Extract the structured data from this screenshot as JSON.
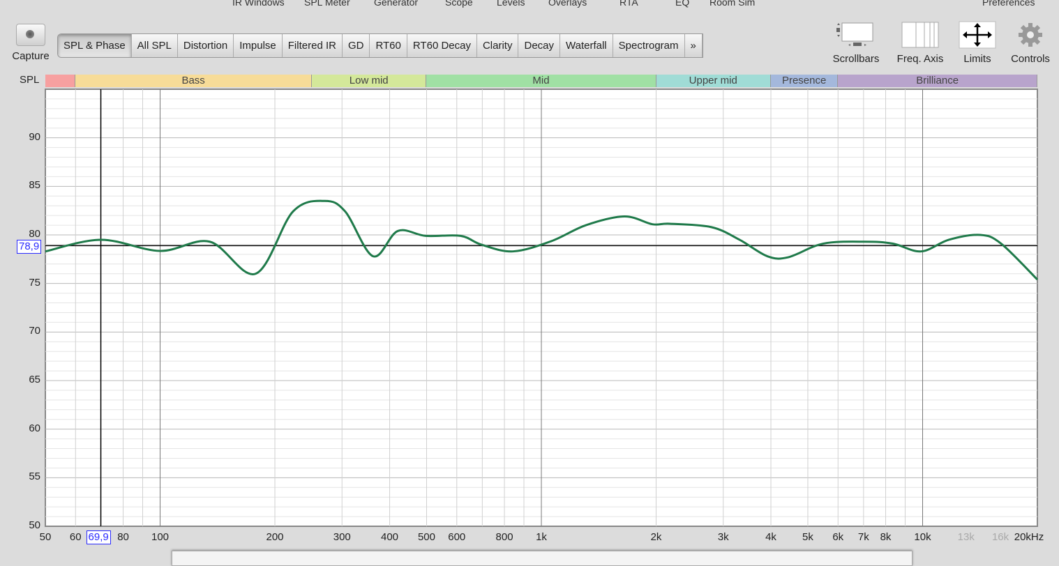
{
  "top_menu": [
    "IR Windows",
    "SPL Meter",
    "Generator",
    "Scope",
    "Levels",
    "Overlays",
    "RTA",
    "EQ",
    "Room Sim",
    "Preferences"
  ],
  "capture_label": "Capture",
  "tabs": [
    "SPL & Phase",
    "All SPL",
    "Distortion",
    "Impulse",
    "Filtered IR",
    "GD",
    "RT60",
    "RT60 Decay",
    "Clarity",
    "Decay",
    "Waterfall",
    "Spectrogram",
    "»"
  ],
  "active_tab": "SPL & Phase",
  "tools": [
    "Scrollbars",
    "Freq. Axis",
    "Limits",
    "Controls"
  ],
  "cursor": {
    "freq_label": "69,9",
    "spl_label": "78,9",
    "freq": 69.9,
    "spl": 78.9
  },
  "chart_data": {
    "type": "line",
    "ylabel": "SPL",
    "xscale": "log",
    "xlim": [
      50,
      20000
    ],
    "ylim": [
      50,
      95
    ],
    "yticks": [
      50,
      55,
      60,
      65,
      70,
      75,
      80,
      85,
      90
    ],
    "xticks": [
      {
        "v": 50,
        "l": "50"
      },
      {
        "v": 60,
        "l": "60"
      },
      {
        "v": 80,
        "l": "80"
      },
      {
        "v": 100,
        "l": "100"
      },
      {
        "v": 200,
        "l": "200"
      },
      {
        "v": 300,
        "l": "300"
      },
      {
        "v": 400,
        "l": "400"
      },
      {
        "v": 500,
        "l": "500"
      },
      {
        "v": 600,
        "l": "600"
      },
      {
        "v": 800,
        "l": "800"
      },
      {
        "v": 1000,
        "l": "1k"
      },
      {
        "v": 2000,
        "l": "2k"
      },
      {
        "v": 3000,
        "l": "3k"
      },
      {
        "v": 4000,
        "l": "4k"
      },
      {
        "v": 5000,
        "l": "5k"
      },
      {
        "v": 6000,
        "l": "6k"
      },
      {
        "v": 7000,
        "l": "7k"
      },
      {
        "v": 8000,
        "l": "8k"
      },
      {
        "v": 10000,
        "l": "10k"
      },
      {
        "v": 13000,
        "l": "13k",
        "dim": true
      },
      {
        "v": 16000,
        "l": "16k",
        "dim": true
      },
      {
        "v": 20000,
        "l": "20kHz"
      }
    ],
    "bands": [
      {
        "name": "",
        "from": 20,
        "to": 60,
        "color": "#f7a0a0"
      },
      {
        "name": "Bass",
        "from": 60,
        "to": 250,
        "color": "#f7dc98"
      },
      {
        "name": "Low mid",
        "from": 250,
        "to": 500,
        "color": "#d4e89a"
      },
      {
        "name": "Mid",
        "from": 500,
        "to": 2000,
        "color": "#a0e0a4"
      },
      {
        "name": "Upper mid",
        "from": 2000,
        "to": 4000,
        "color": "#a0dcd6"
      },
      {
        "name": "Presence",
        "from": 4000,
        "to": 6000,
        "color": "#a4b8dc"
      },
      {
        "name": "Brilliance",
        "from": 6000,
        "to": 20000,
        "color": "#b8a4cc"
      }
    ],
    "series": [
      {
        "name": "SPL",
        "color": "#1f7a4a",
        "points": [
          [
            50,
            78.3
          ],
          [
            70,
            79.5
          ],
          [
            100,
            78.35
          ],
          [
            135,
            79.3
          ],
          [
            178,
            76.0
          ],
          [
            223,
            82.4
          ],
          [
            270,
            83.5
          ],
          [
            306,
            82.4
          ],
          [
            362,
            77.8
          ],
          [
            420,
            80.4
          ],
          [
            497,
            79.9
          ],
          [
            614,
            79.9
          ],
          [
            696,
            79.0
          ],
          [
            842,
            78.3
          ],
          [
            1061,
            79.35
          ],
          [
            1309,
            81.0
          ],
          [
            1652,
            81.9
          ],
          [
            1955,
            81.1
          ],
          [
            2172,
            81.15
          ],
          [
            2793,
            80.8
          ],
          [
            3310,
            79.5
          ],
          [
            3917,
            77.8
          ],
          [
            4444,
            77.7
          ],
          [
            5483,
            79.1
          ],
          [
            7063,
            79.3
          ],
          [
            8357,
            79.1
          ],
          [
            9908,
            78.3
          ],
          [
            11720,
            79.5
          ],
          [
            14160,
            80.0
          ],
          [
            16070,
            79.1
          ],
          [
            20000,
            75.4
          ]
        ]
      }
    ]
  }
}
